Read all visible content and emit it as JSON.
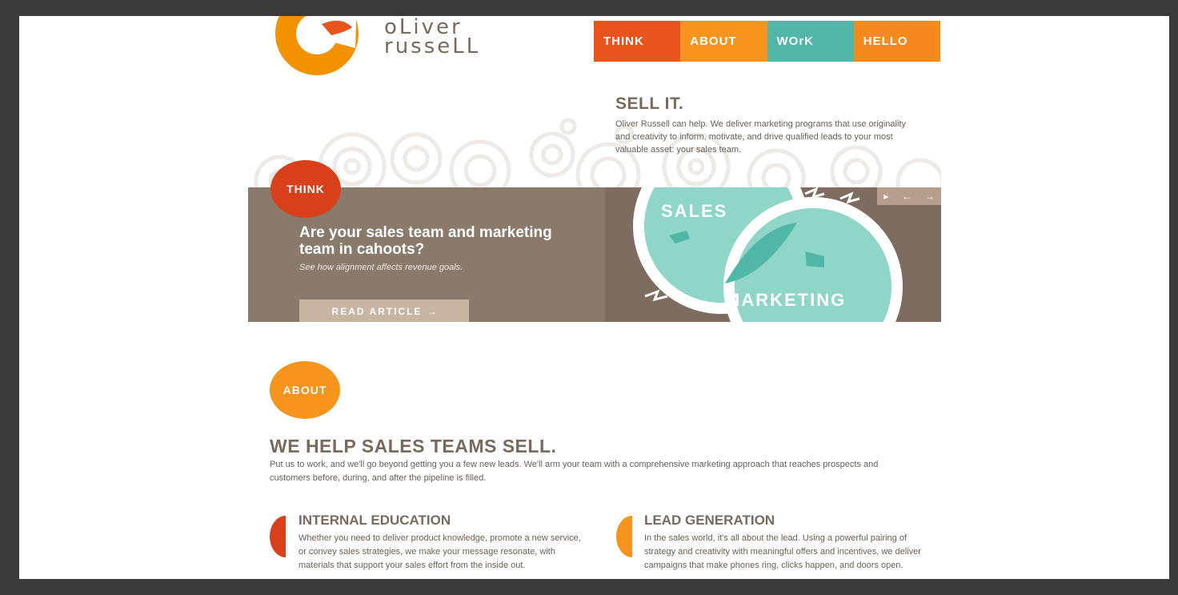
{
  "brand": {
    "line1": "oLiver",
    "line2": "russeLL",
    "colors": {
      "orange": "#f29200",
      "red": "#d7401b",
      "teal": "#4fb6a8",
      "taupe": "#8a7a6c",
      "text": "#7a6a5e"
    }
  },
  "nav": {
    "items": [
      {
        "label": "THINK"
      },
      {
        "label": "ABOUT"
      },
      {
        "label": "WOrK"
      },
      {
        "label": "HELLO"
      }
    ]
  },
  "intro": {
    "title": "SELL IT.",
    "body": "Oliver Russell can help. We deliver marketing programs that use originality and creativity to inform, motivate, and drive qualified leads to your most valuable asset: your sales team."
  },
  "think": {
    "badge": "THINK",
    "headline": "Are your sales team and marketing team in cahoots?",
    "subhead": "See how alignment affects revenue goals.",
    "button": "READ ARTICLE",
    "art_labels": {
      "sales": "SALES",
      "marketing": "MARKETING"
    },
    "slider": {
      "play": "▸",
      "prev": "←",
      "next": "→"
    }
  },
  "about": {
    "badge": "ABOUT",
    "title": "WE HELP SALES TEAMS SELL.",
    "body": "Put us to work, and we'll go beyond getting you a few new leads. We'll arm your team with a comprehensive marketing approach that reaches prospects and customers before, during, and after the pipeline is filled.",
    "columns": [
      {
        "title": "INTERNAL EDUCATION",
        "body": "Whether you need to deliver product knowledge, promote a new service, or convey sales strategies, we make your message resonate, with materials that support your sales effort from the inside out."
      },
      {
        "title": "LEAD GENERATION",
        "body": "In the sales world, it's all about the lead. Using a powerful pairing of strategy and creativity with meaningful offers and incentives, we deliver campaigns that make phones ring, clicks happen, and doors open."
      }
    ]
  }
}
